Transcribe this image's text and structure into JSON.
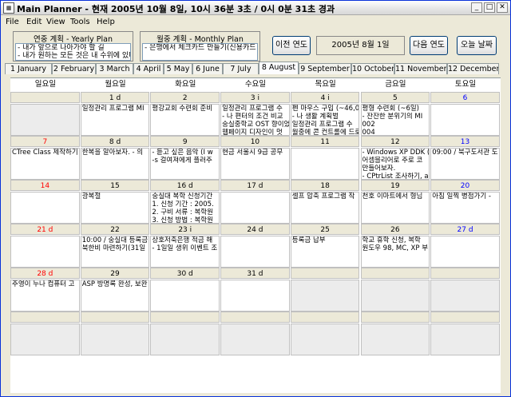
{
  "window": {
    "title": "Main Planner - 현재 2005년 10월 8일, 10시 36분 3초 / 0시 0분 31초 경과",
    "icon": "planner-app-icon"
  },
  "menu": [
    "File",
    "Edit",
    "View",
    "Tools",
    "Help"
  ],
  "yearly": {
    "title": "연중 계획 - Yearly Plan",
    "lines": [
      "- 내가 앞으로 나아가야 할 길",
      "- 내가 원하는 모든 것은 내 수위에 있다."
    ]
  },
  "monthly": {
    "title": "월중 계획 - Monthly Plan",
    "lines": [
      "- 은행에서 체크카드 만들기(신용카드"
    ]
  },
  "buttons": {
    "prev_year": "이전 연도",
    "next_year": "다음 연도",
    "today": "오늘 날짜"
  },
  "current_date": "2005년 8월 1일",
  "months": [
    "1 January",
    "2 February",
    "3 March",
    "4 April",
    "5 May",
    "6 June",
    "7 July",
    "8 August",
    "9 September",
    "10 October",
    "11 November",
    "12 December"
  ],
  "active_month": "8 August",
  "weekdays": [
    "일요일",
    "월요일",
    "화요일",
    "수요일",
    "목요일",
    "금요일",
    "토요일"
  ],
  "weeks": [
    {
      "nums": [
        "",
        "1 d",
        "2",
        "3  i",
        "4  i",
        "5",
        "6"
      ],
      "notes": [
        [],
        [
          "일정관리 프로그램 MI"
        ],
        [
          "평강교회 수련회 준비"
        ],
        [
          "일정관리 프로그램 수",
          "- 나 편터의 조건 비교",
          "숭실중학교 OST 향이었",
          "웹페이지 디자인이 멋"
        ],
        [
          "펜 마우스 구입 (~46,0",
          "- 나 생활 계획벌",
          "일정관리 프로그램 수",
          "월중에 콘 컨트롤에 드로"
        ],
        [
          "평형 수련회 (~6일)",
          "- 잔잔한 분위기의 MI",
          "002",
          "004"
        ],
        []
      ]
    },
    {
      "nums": [
        "7",
        "8 d",
        "9",
        "10",
        "11",
        "12",
        "13"
      ],
      "notes": [
        [
          "CTree Class 제작하기"
        ],
        [
          "한복을 알아보자. - 의"
        ],
        [
          "- 듣고 싶은 음악 (I w",
          "-s 걸여져에게 플러주"
        ],
        [
          "현금 서울시 9급 공무"
        ],
        [],
        [
          "- Windows XP DDK (",
          "어셈블리어로 주로 코",
          "만들어보자.",
          "- CPtrList 조사하기, a"
        ],
        [
          "09:00 / 북구도서관 도"
        ]
      ]
    },
    {
      "nums": [
        "14",
        "15",
        "16 d",
        "17 d",
        "18",
        "19",
        "20"
      ],
      "notes": [
        [],
        [
          "광복절"
        ],
        [
          "숭실대 복학 신청기간",
          "1. 신청 기간 : 2005.",
          "2. 구비 서류 : 복학원",
          "3. 신청 방법 : 복학원"
        ],
        [],
        [
          "셀프 압축 프로그램 작"
        ],
        [
          "천호 이마트에서 형님"
        ],
        [
          "아침 일찍 병점가기 -"
        ]
      ]
    },
    {
      "nums": [
        "21 d",
        "22",
        "23  i",
        "24 d",
        "25",
        "26",
        "27 d"
      ],
      "notes": [
        [],
        [
          "10:00 / 숭실대 등록금",
          "북한비 마련하기(31일"
        ],
        [
          "상호저축은행 적금 해",
          "- 1일일 생위 이벤트 조"
        ],
        [],
        [
          "등록금 납부"
        ],
        [
          "학교 휴학 신청, 복학",
          "원도우 98, MC, XP 부"
        ],
        []
      ]
    },
    {
      "nums": [
        "28 d",
        "29",
        "30 d",
        "31 d",
        "",
        "",
        ""
      ],
      "notes": [
        [
          "주영이 누나 컴퓨터 고"
        ],
        [
          "ASP 방명록 완성, 보완"
        ],
        [],
        [],
        [],
        [],
        []
      ]
    },
    {
      "nums": [
        "",
        "",
        "",
        "",
        "",
        "",
        ""
      ],
      "notes": [
        [],
        [],
        [],
        [],
        [],
        [],
        []
      ]
    }
  ],
  "colors": {
    "sunday": "#ff0000",
    "saturday": "#0000ff",
    "grid": "#c0c0c0",
    "header_bg": "#ece9d8"
  }
}
